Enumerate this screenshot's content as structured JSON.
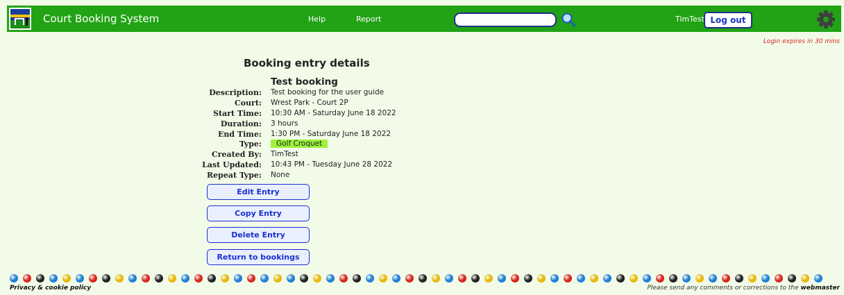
{
  "header": {
    "app_title": "Court Booking System",
    "nav": [
      "Help",
      "Report"
    ],
    "search": {
      "value": "",
      "placeholder": ""
    },
    "username": "TimTest",
    "logout_label": "Log out",
    "brand_color": "#21a315"
  },
  "login_expiry": "Login expires in 30 mins",
  "main": {
    "title": "Booking entry details",
    "entry_name": "Test booking",
    "details": [
      {
        "label": "Description:",
        "value": "Test booking for the user guide"
      },
      {
        "label": "Court:",
        "value": "Wrest Park - Court 2P"
      },
      {
        "label": "Start Time:",
        "value": "10:30 AM - Saturday June 18 2022"
      },
      {
        "label": "Duration:",
        "value": "3 hours"
      },
      {
        "label": "End Time:",
        "value": "1:30 PM - Saturday June 18 2022"
      },
      {
        "label": "Type:",
        "value": "Golf Croquet"
      },
      {
        "label": "Created By:",
        "value": "TimTest"
      },
      {
        "label": "Last Updated:",
        "value": "10:43 PM - Tuesday June 28 2022"
      },
      {
        "label": "Repeat Type:",
        "value": "None"
      }
    ],
    "type_color": "#9cf23a",
    "actions": [
      "Edit Entry",
      "Copy Entry",
      "Delete Entry",
      "Return to bookings"
    ]
  },
  "footer": {
    "privacy_label": "Privacy & cookie policy",
    "note_text": "Please send any comments or corrections to the",
    "webmaster_label": "webmaster",
    "ball_colors": [
      "#1f7fd6",
      "#d7261e",
      "#222222",
      "#e8b80c"
    ]
  }
}
